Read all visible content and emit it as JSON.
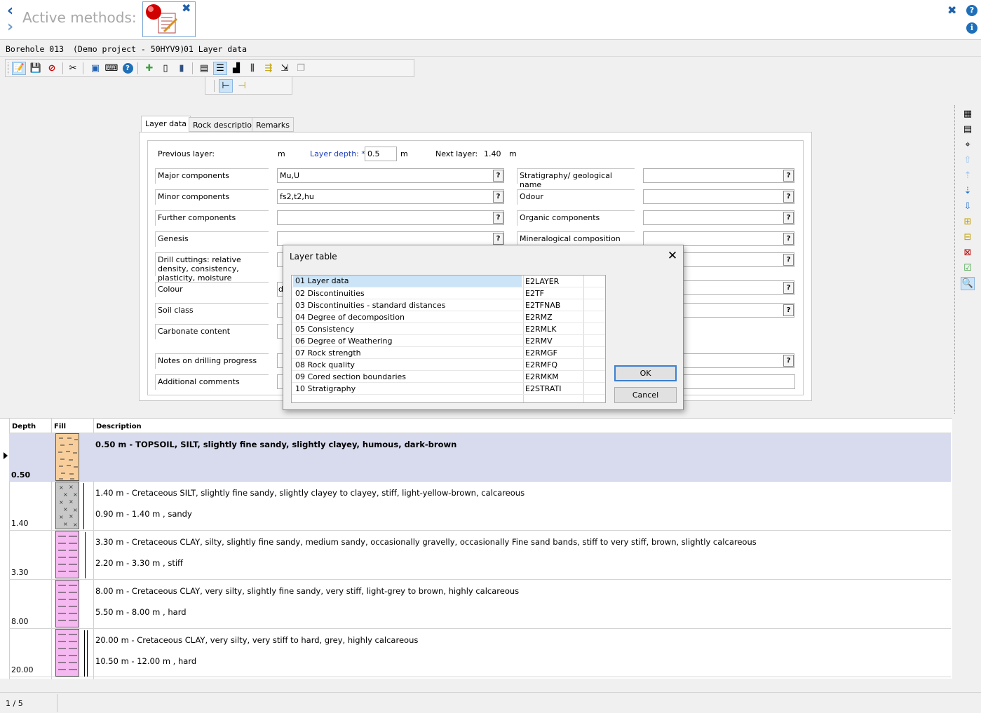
{
  "header": {
    "title": "Active methods:",
    "method_icon": "layer-data-method-icon"
  },
  "breadcrumb": {
    "borehole": "Borehole 013",
    "project": "(Demo project - 50HYV9)",
    "method": "01 Layer data"
  },
  "tabs": [
    {
      "label": "Layer data",
      "active": true
    },
    {
      "label": "Rock description",
      "active": false
    },
    {
      "label": "Remarks",
      "active": false
    }
  ],
  "form": {
    "previous_layer_label": "Previous layer:",
    "unit_m": "m",
    "layer_depth_label": "Layer depth:",
    "layer_depth_required": "*",
    "layer_depth_value": "0.5",
    "next_layer_label": "Next layer:",
    "next_layer_value": "1.40",
    "left_fields": [
      {
        "label": "Major components",
        "value": "Mu,U"
      },
      {
        "label": "Minor components",
        "value": "fs2,t2,hu"
      },
      {
        "label": "Further components",
        "value": ""
      },
      {
        "label": "Genesis",
        "value": ""
      },
      {
        "label": "Drill cuttings: relative density, consistency, plasticity, moisture",
        "value": ""
      },
      {
        "label": "Colour",
        "value": "d"
      },
      {
        "label": "Soil class",
        "value": ""
      },
      {
        "label": "Carbonate content",
        "value": ""
      },
      {
        "label": "Notes on drilling progress",
        "value": ""
      },
      {
        "label": "Additional comments",
        "value": ""
      }
    ],
    "right_fields": [
      {
        "label": "Stratigraphy/ geological name",
        "value": ""
      },
      {
        "label": "Odour",
        "value": ""
      },
      {
        "label": "Organic components",
        "value": ""
      },
      {
        "label": "Mineralogical composition",
        "value": ""
      }
    ],
    "help_glyph": "?"
  },
  "dialog": {
    "title": "Layer table",
    "close_glyph": "✕",
    "rows": [
      {
        "name": "01 Layer data",
        "code": "E2LAYER",
        "selected": true
      },
      {
        "name": "02 Discontinuities",
        "code": "E2TF"
      },
      {
        "name": "03 Discontinuities - standard distances",
        "code": "E2TFNAB"
      },
      {
        "name": "04 Degree of decomposition",
        "code": "E2RMZ"
      },
      {
        "name": "05 Consistency",
        "code": "E2RMLK"
      },
      {
        "name": "06 Degree of Weathering",
        "code": "E2RMV"
      },
      {
        "name": "07 Rock strength",
        "code": "E2RMGF"
      },
      {
        "name": "08 Rock quality",
        "code": "E2RMFQ"
      },
      {
        "name": "09 Cored section boundaries",
        "code": "E2RMKM"
      },
      {
        "name": "10 Stratigraphy",
        "code": "E2STRATI"
      }
    ],
    "ok_label": "OK",
    "cancel_label": "Cancel"
  },
  "log": {
    "headers": {
      "depth": "Depth",
      "fill": "Fill",
      "description": "Description"
    },
    "layers": [
      {
        "depth": "0.50",
        "line1": "0.50 m - TOPSOIL, SILT, slightly fine sandy, slightly clayey, humous, dark-brown",
        "line2": "",
        "fill_color": "#f8cf9c"
      },
      {
        "depth": "1.40",
        "line1": "1.40 m - Cretaceous SILT, slightly fine sandy, slightly clayey to clayey, stiff, light-yellow-brown, calcareous",
        "line2": "0.90 m - 1.40 m , sandy",
        "fill_color": "#c8c8c8"
      },
      {
        "depth": "3.30",
        "line1": "3.30 m - Cretaceous CLAY, silty, slightly fine sandy, medium sandy, occasionally gravelly, occasionally Fine sand bands, stiff to very stiff, brown, slightly calcareous",
        "line2": "2.20 m - 3.30 m , stiff",
        "fill_color": "#f6b8f0"
      },
      {
        "depth": "8.00",
        "line1": "8.00 m - Cretaceous CLAY, very silty, slightly fine sandy, very stiff, light-grey to brown, highly calcareous",
        "line2": "5.50 m - 8.00 m , hard",
        "fill_color": "#f6b8f0"
      },
      {
        "depth": "20.00",
        "line1": "20.00 m - Cretaceous CLAY, very silty, very stiff to hard, grey, highly calcareous",
        "line2": "10.50 m - 12.00 m , hard",
        "fill_color": "#f6b8f0"
      }
    ]
  },
  "status": {
    "page": "1 / 5"
  },
  "colors": {
    "accent": "#1f5fa8",
    "selection": "#cce4f7",
    "selected_row": "#d8dbee"
  }
}
